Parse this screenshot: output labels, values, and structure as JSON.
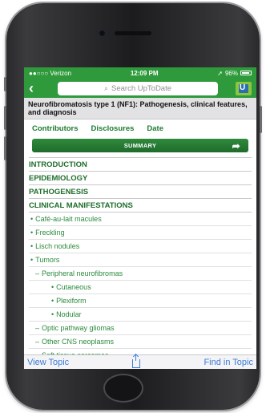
{
  "status": {
    "carrier": "●●○○○ Verizon",
    "time": "12:09 PM",
    "battery": "96%"
  },
  "nav": {
    "search_placeholder": "Search UpToDate",
    "logo_letter": "U"
  },
  "topic": {
    "title": "Neurofibromatosis type 1 (NF1): Pathogenesis, clinical features, and diagnosis",
    "meta": [
      "Contributors",
      "Disclosures",
      "Date"
    ],
    "summary_label": "SUMMARY"
  },
  "outline": [
    {
      "type": "section",
      "label": "INTRODUCTION"
    },
    {
      "type": "section",
      "label": "EPIDEMIOLOGY"
    },
    {
      "type": "section",
      "label": "PATHOGENESIS"
    },
    {
      "type": "section",
      "label": "CLINICAL MANIFESTATIONS"
    },
    {
      "type": "item",
      "level": 1,
      "marker": "•",
      "label": "Café-au-lait macules"
    },
    {
      "type": "item",
      "level": 1,
      "marker": "•",
      "label": "Freckling"
    },
    {
      "type": "item",
      "level": 1,
      "marker": "•",
      "label": "Lisch nodules"
    },
    {
      "type": "item",
      "level": 1,
      "marker": "•",
      "label": "Tumors"
    },
    {
      "type": "item",
      "level": 2,
      "marker": "–",
      "label": "Peripheral neurofibromas"
    },
    {
      "type": "item",
      "level": 3,
      "marker": "•",
      "label": "Cutaneous"
    },
    {
      "type": "item",
      "level": 3,
      "marker": "•",
      "label": "Plexiform"
    },
    {
      "type": "item",
      "level": 3,
      "marker": "•",
      "label": "Nodular"
    },
    {
      "type": "item",
      "level": 2,
      "marker": "–",
      "label": "Optic pathway gliomas"
    },
    {
      "type": "item",
      "level": 2,
      "marker": "–",
      "label": "Other CNS neoplasms"
    },
    {
      "type": "item",
      "level": 2,
      "marker": "–",
      "label": "Soft tissue sarcomas"
    }
  ],
  "bottom": {
    "left_label": "View Topic",
    "right_label": "Find in Topic"
  },
  "colors": {
    "brand_green": "#2e9a3b",
    "link_blue": "#3a7bd5"
  }
}
